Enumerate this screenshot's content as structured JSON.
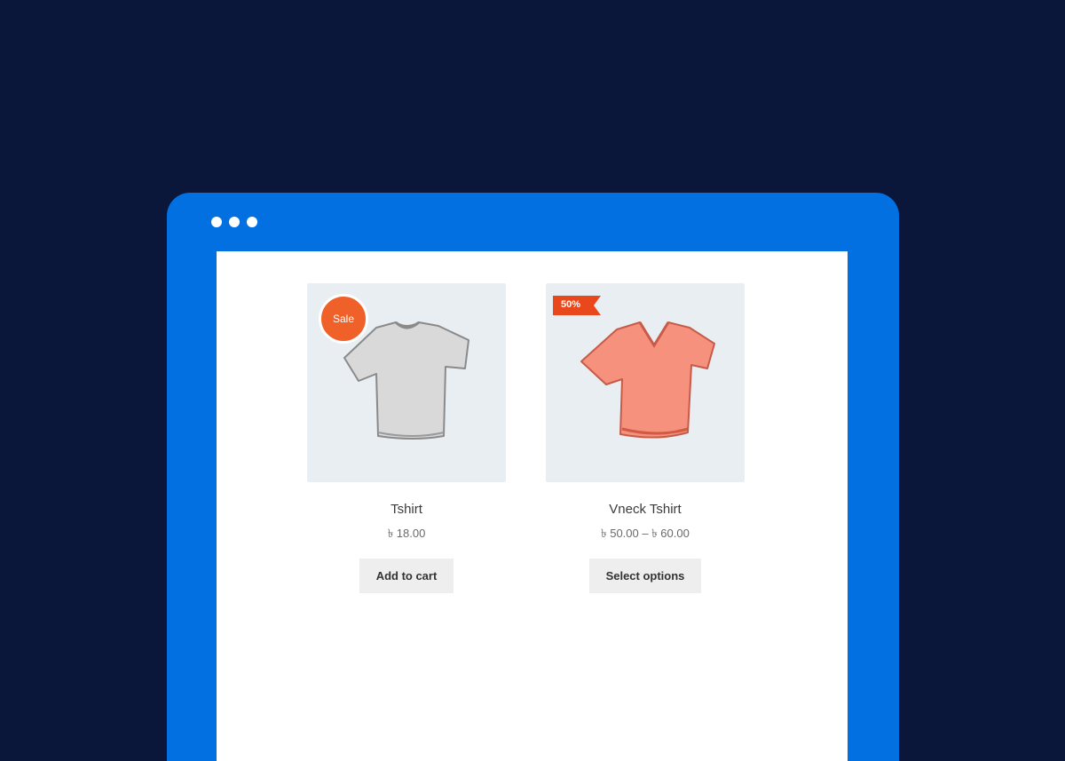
{
  "products": [
    {
      "title": "Tshirt",
      "price": "৳ 18.00",
      "badge": "Sale",
      "button_label": "Add to cart",
      "shirt_color": "#d8d8d8"
    },
    {
      "title": "Vneck Tshirt",
      "price": "৳ 50.00 – ৳ 60.00",
      "badge": "50%",
      "button_label": "Select options",
      "shirt_color": "#f28b78"
    }
  ],
  "colors": {
    "background": "#0a173a",
    "browser_frame": "#0370e1",
    "badge_orange": "#f0612a",
    "flag_red": "#e8481c"
  }
}
